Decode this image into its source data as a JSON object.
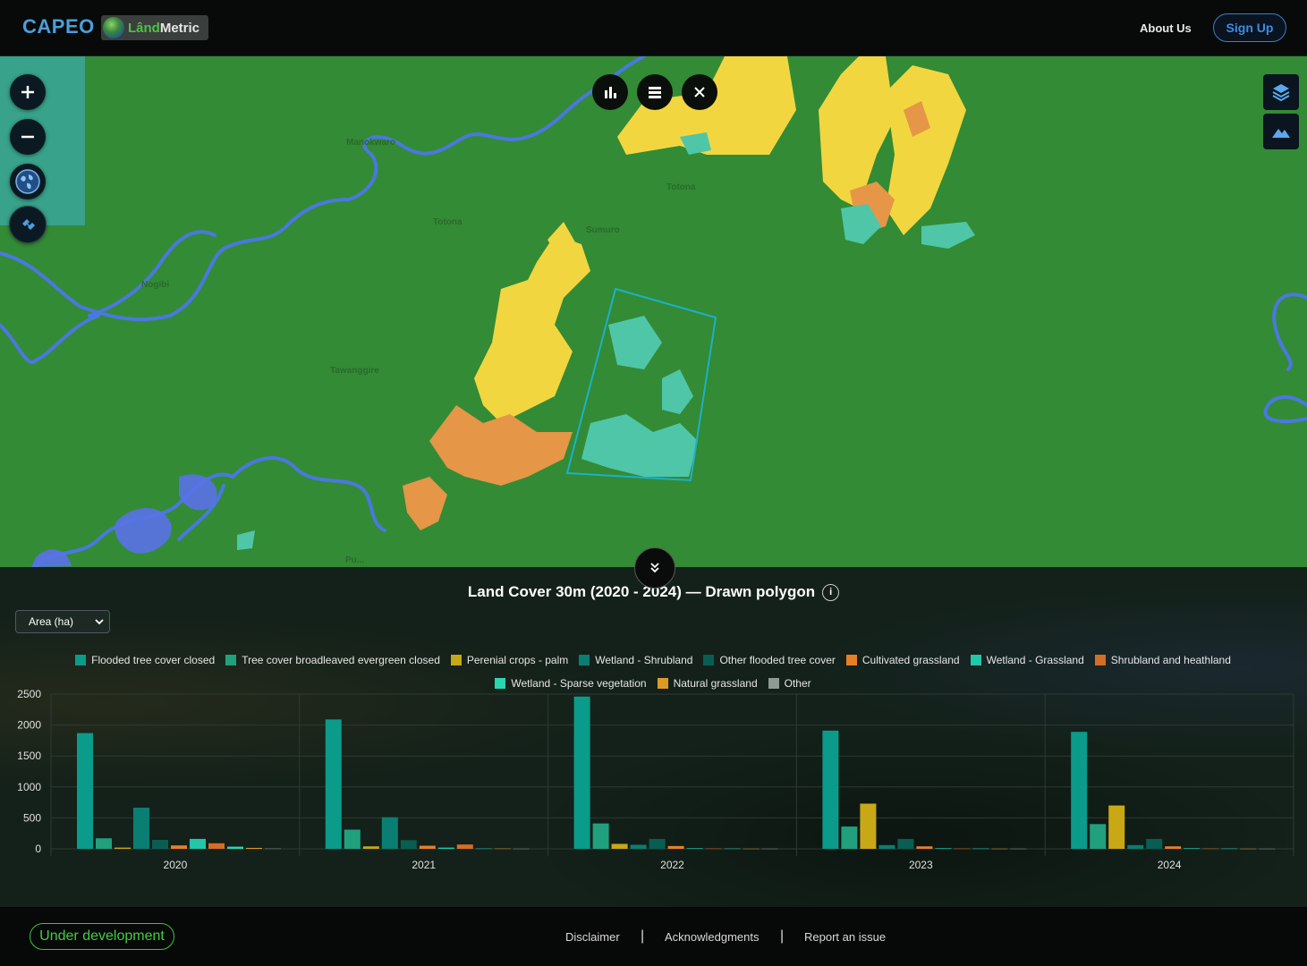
{
  "header": {
    "brand": "CAPEO",
    "partner_logo": {
      "part1": "Lând",
      "part2": "Metric"
    },
    "about_label": "About Us",
    "signup_label": "Sign Up"
  },
  "map": {
    "place_labels": [
      "Manokwaro",
      "Totona",
      "Sumuro",
      "Totona",
      "Nogibi",
      "Tawanggire",
      "Pu..."
    ],
    "controls": [
      "zoom-in-icon",
      "zoom-out-icon",
      "globe-icon",
      "satellite-icon"
    ],
    "toolbar": [
      "bar-chart-icon",
      "list-icon",
      "close-icon"
    ],
    "side_controls": [
      "layers-icon",
      "terrain-icon"
    ]
  },
  "panel": {
    "title": "Land Cover 30m (2020 - 2024) — Drawn polygon",
    "info_glyph": "i",
    "metric_select": "Area (ha)"
  },
  "chart_data": {
    "type": "bar",
    "categories": [
      "2020",
      "2021",
      "2022",
      "2023",
      "2024"
    ],
    "ylim": [
      0,
      2500
    ],
    "yticks": [
      0,
      500,
      1000,
      1500,
      2000,
      2500
    ],
    "legend_placement": "top",
    "grid": true,
    "series": [
      {
        "name": "Flooded tree cover closed",
        "color": "#0b9b8a",
        "values": [
          1870,
          2090,
          2460,
          1910,
          1890
        ]
      },
      {
        "name": "Tree cover broadleaved evergreen closed",
        "color": "#21a07d",
        "values": [
          170,
          310,
          410,
          360,
          400
        ]
      },
      {
        "name": "Perenial crops - palm",
        "color": "#c9a816",
        "values": [
          20,
          40,
          80,
          730,
          700
        ]
      },
      {
        "name": "Wetland - Shrubland",
        "color": "#0a7e72",
        "values": [
          665,
          510,
          65,
          60,
          60
        ]
      },
      {
        "name": "Other flooded tree cover",
        "color": "#085e52",
        "values": [
          145,
          140,
          160,
          160,
          160
        ]
      },
      {
        "name": "Cultivated grassland",
        "color": "#e87f26",
        "values": [
          55,
          50,
          45,
          40,
          40
        ]
      },
      {
        "name": "Wetland - Grassland",
        "color": "#22c7a9",
        "values": [
          160,
          20,
          10,
          10,
          10
        ]
      },
      {
        "name": "Shrubland and heathland",
        "color": "#d46e24",
        "values": [
          90,
          70,
          5,
          5,
          5
        ]
      },
      {
        "name": "Wetland - Sparse vegetation",
        "color": "#2ad6b0",
        "values": [
          35,
          5,
          5,
          5,
          5
        ]
      },
      {
        "name": "Natural grassland",
        "color": "#dc9a25",
        "values": [
          15,
          5,
          3,
          3,
          3
        ]
      },
      {
        "name": "Other",
        "color": "#8e9a94",
        "values": [
          5,
          3,
          3,
          3,
          3
        ]
      }
    ]
  },
  "footer": {
    "dev_badge": "Under development",
    "links": [
      "Disclaimer",
      "Acknowledgments",
      "Report an issue"
    ],
    "separator": "|"
  }
}
